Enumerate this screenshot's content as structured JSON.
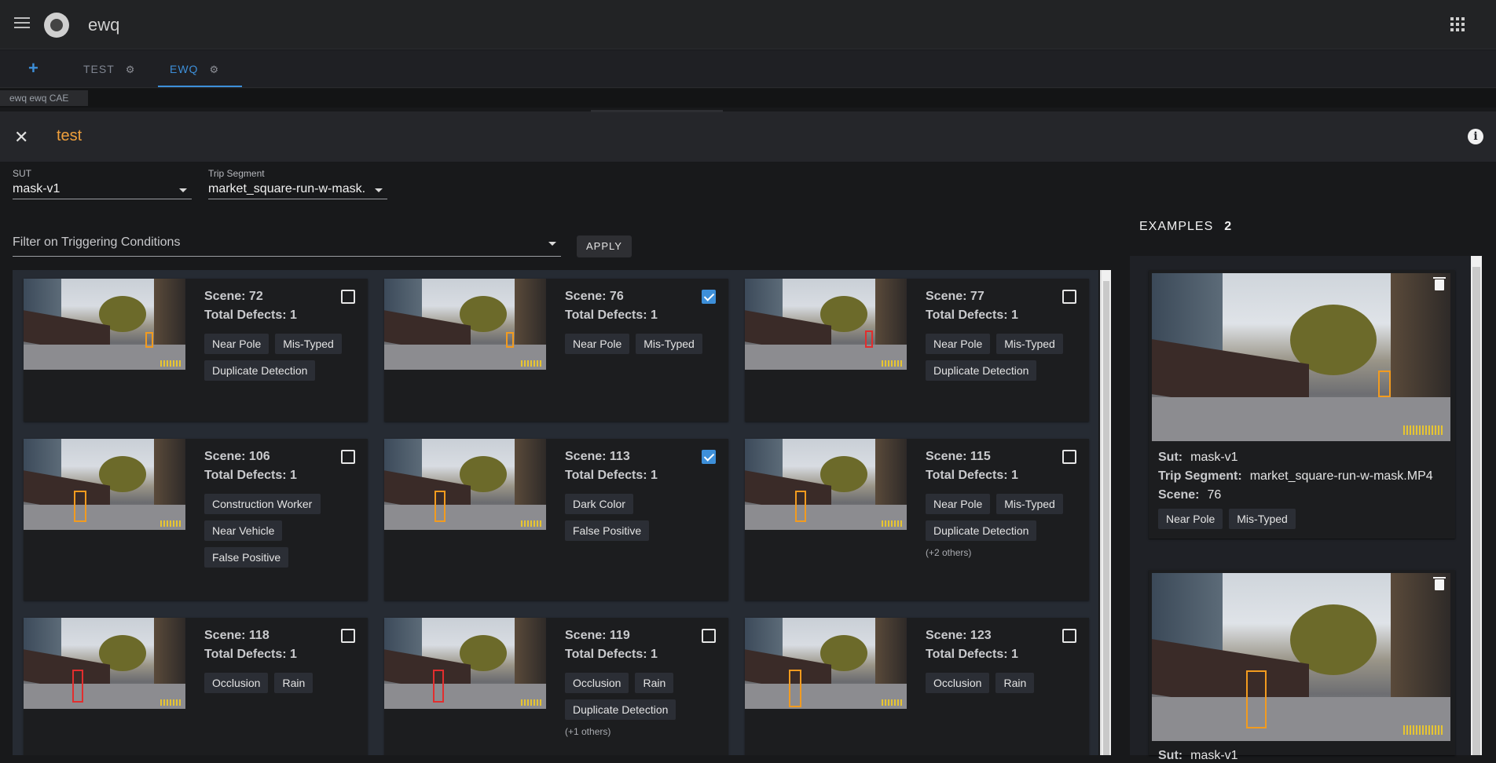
{
  "app": {
    "title": "ewq"
  },
  "tabs": {
    "add": "+",
    "items": [
      {
        "label": "TEST"
      },
      {
        "label": "EWQ"
      }
    ],
    "active": "EWQ",
    "gear": "⚙"
  },
  "subtab": {
    "label": "ewq ewq CAE"
  },
  "panel": {
    "close": "✕",
    "title": "test",
    "info": "i"
  },
  "filters": {
    "sut": {
      "label": "SUT",
      "value": "mask-v1"
    },
    "trip_segment": {
      "label": "Trip Segment",
      "value": "market_square-run-w-mask."
    },
    "triggering": {
      "placeholder": "Filter on Triggering Conditions"
    },
    "apply": "APPLY"
  },
  "examples": {
    "title": "EXAMPLES",
    "count": "2",
    "items": [
      {
        "sut_label": "Sut:",
        "sut": "mask-v1",
        "trip_label": "Trip Segment:",
        "trip": "market_square-run-w-mask.MP4",
        "scene_label": "Scene:",
        "scene": "76",
        "tags": [
          "Near Pole",
          "Mis-Typed"
        ]
      },
      {
        "sut_label": "Sut:",
        "sut": "mask-v1"
      }
    ]
  },
  "scenes": [
    {
      "scene": "Scene: 72",
      "defects": "Total Defects: 1",
      "checked": false,
      "tags": [
        "Near Pole",
        "Mis-Typed",
        "Duplicate Detection"
      ],
      "others": ""
    },
    {
      "scene": "Scene: 76",
      "defects": "Total Defects: 1",
      "checked": true,
      "tags": [
        "Near Pole",
        "Mis-Typed"
      ],
      "others": ""
    },
    {
      "scene": "Scene: 77",
      "defects": "Total Defects: 1",
      "checked": false,
      "tags": [
        "Near Pole",
        "Mis-Typed",
        "Duplicate Detection"
      ],
      "others": ""
    },
    {
      "scene": "Scene: 106",
      "defects": "Total Defects: 1",
      "checked": false,
      "tags": [
        "Construction Worker",
        "Near Vehicle",
        "False Positive"
      ],
      "others": ""
    },
    {
      "scene": "Scene: 113",
      "defects": "Total Defects: 1",
      "checked": true,
      "tags": [
        "Dark Color",
        "False Positive"
      ],
      "others": ""
    },
    {
      "scene": "Scene: 115",
      "defects": "Total Defects: 1",
      "checked": false,
      "tags": [
        "Near Pole",
        "Mis-Typed",
        "Duplicate Detection"
      ],
      "others": "(+2 others)"
    },
    {
      "scene": "Scene: 118",
      "defects": "Total Defects: 1",
      "checked": false,
      "tags": [
        "Occlusion",
        "Rain"
      ],
      "others": ""
    },
    {
      "scene": "Scene: 119",
      "defects": "Total Defects: 1",
      "checked": false,
      "tags": [
        "Occlusion",
        "Rain",
        "Duplicate Detection"
      ],
      "others": "(+1 others)"
    },
    {
      "scene": "Scene: 123",
      "defects": "Total Defects: 1",
      "checked": false,
      "tags": [
        "Occlusion",
        "Rain"
      ],
      "others": ""
    }
  ],
  "colors": {
    "accent": "#3d8fd9",
    "title": "#f0a03c",
    "bbox_orange": "#f29b1f",
    "bbox_red": "#e12e2e"
  }
}
